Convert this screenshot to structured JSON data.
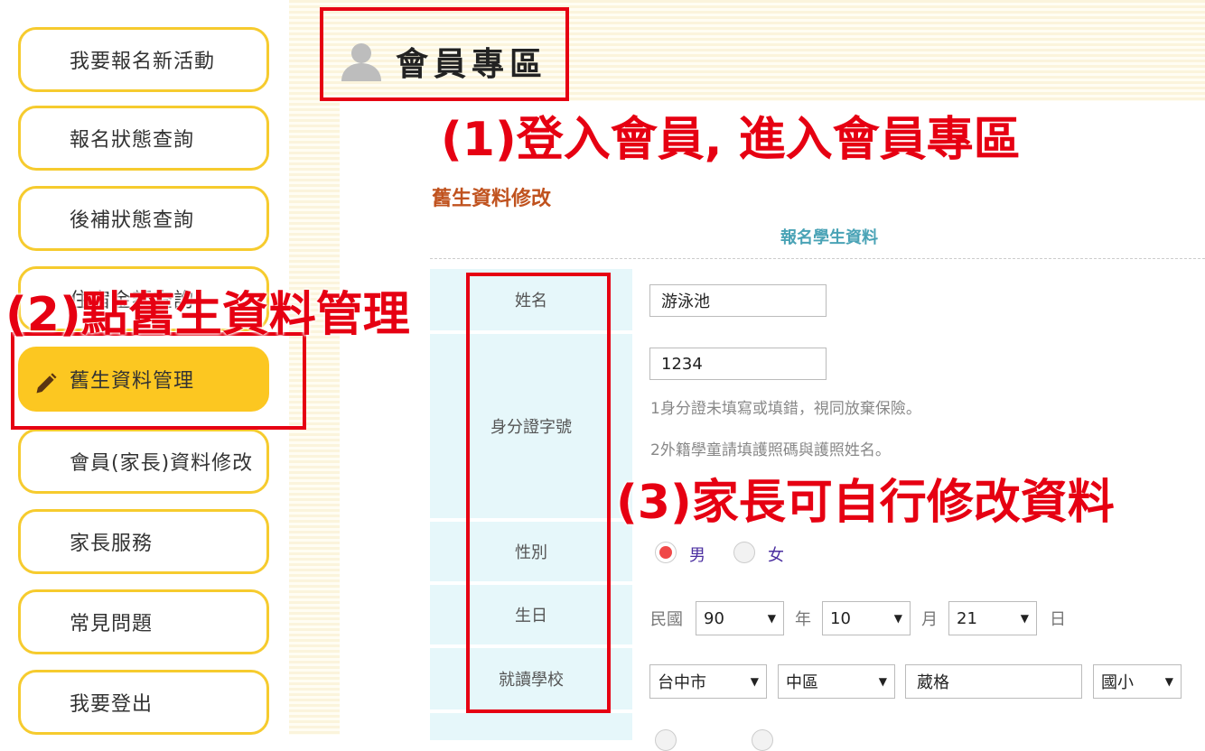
{
  "sidebar": {
    "items": [
      {
        "label": "我要報名新活動"
      },
      {
        "label": "報名狀態查詢"
      },
      {
        "label": "後補狀態查詢"
      },
      {
        "label": "住宿金額查詢"
      },
      {
        "label": "舊生資料管理"
      },
      {
        "label": "會員(家長)資料修改"
      },
      {
        "label": "家長服務"
      },
      {
        "label": "常見問題"
      },
      {
        "label": "我要登出"
      }
    ]
  },
  "header": {
    "title": "會員專區"
  },
  "annotations": {
    "step1": "(1)登入會員, 進入會員專區",
    "step2": "(2)點舊生資料管理",
    "step3": "(3)家長可自行修改資料"
  },
  "main": {
    "section_title": "舊生資料修改",
    "form_heading": "報名學生資料",
    "labels": {
      "name": "姓名",
      "id": "身分證字號",
      "gender": "性別",
      "birthday": "生日",
      "school": "就讀學校"
    },
    "fields": {
      "name": "游泳池",
      "id": "1234",
      "id_hint_1": "1身分證未填寫或填錯，視同放棄保險。",
      "id_hint_2": "2外籍學童請填護照碼與護照姓名。",
      "gender_male": "男",
      "gender_female": "女",
      "gender_selected": "男",
      "birthday_prefix": "民國",
      "birthday_year": "90",
      "birthday_year_unit": "年",
      "birthday_month": "10",
      "birthday_month_unit": "月",
      "birthday_day": "21",
      "birthday_day_unit": "日",
      "school_city": "台中市",
      "school_district": "中區",
      "school_name": "葳格",
      "school_level": "國小"
    }
  },
  "colors": {
    "accent": "#fcc721",
    "annotation": "#e60012",
    "label_bg": "#e6f7fa",
    "section_title": "#c0521e"
  }
}
